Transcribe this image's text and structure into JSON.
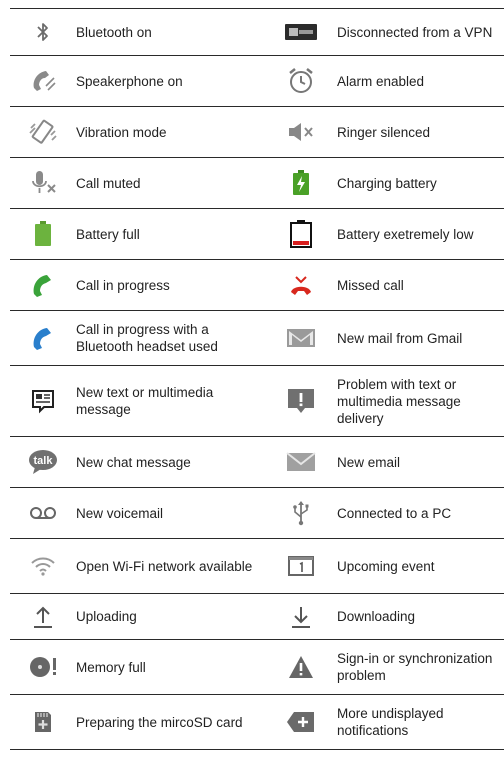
{
  "rows": [
    {
      "left": {
        "icon": "bluetooth-icon",
        "label": "Bluetooth on"
      },
      "right": {
        "icon": "vpn-disconnected-icon",
        "label": "Disconnected from a VPN"
      }
    },
    {
      "left": {
        "icon": "speakerphone-icon",
        "label": "Speakerphone on"
      },
      "right": {
        "icon": "alarm-clock-icon",
        "label": "Alarm enabled"
      }
    },
    {
      "left": {
        "icon": "vibration-icon",
        "label": "Vibration mode"
      },
      "right": {
        "icon": "ringer-silenced-icon",
        "label": "Ringer silenced"
      }
    },
    {
      "left": {
        "icon": "microphone-muted-icon",
        "label": "Call muted"
      },
      "right": {
        "icon": "charging-battery-icon",
        "label": "Charging battery"
      }
    },
    {
      "left": {
        "icon": "battery-full-icon",
        "label": "Battery full"
      },
      "right": {
        "icon": "battery-low-icon",
        "label": "Battery exetremely low"
      }
    },
    {
      "left": {
        "icon": "call-in-progress-icon",
        "label": "Call in progress"
      },
      "right": {
        "icon": "missed-call-icon",
        "label": "Missed call"
      }
    },
    {
      "left": {
        "icon": "bluetooth-call-icon",
        "label": "Call in progress with a Bluetooth headset used"
      },
      "right": {
        "icon": "gmail-icon",
        "label": "New mail from Gmail"
      }
    },
    {
      "left": {
        "icon": "text-message-icon",
        "label": "New text or multimedia message"
      },
      "right": {
        "icon": "message-problem-icon",
        "label": "Problem with text or multimedia message delivery"
      }
    },
    {
      "left": {
        "icon": "talk-chat-icon",
        "label": "New chat message"
      },
      "right": {
        "icon": "email-icon",
        "label": "New email"
      }
    },
    {
      "left": {
        "icon": "voicemail-icon",
        "label": "New voicemail"
      },
      "right": {
        "icon": "usb-icon",
        "label": "Connected to a PC"
      }
    },
    {
      "left": {
        "icon": "wifi-open-icon",
        "label": "Open Wi-Fi network available"
      },
      "right": {
        "icon": "calendar-event-icon",
        "label": "Upcoming event"
      }
    },
    {
      "left": {
        "icon": "upload-icon",
        "label": "Uploading"
      },
      "right": {
        "icon": "download-icon",
        "label": "Downloading"
      }
    },
    {
      "left": {
        "icon": "memory-full-icon",
        "label": "Memory full"
      },
      "right": {
        "icon": "warning-triangle-icon",
        "label": "Sign-in or synchronization problem"
      }
    },
    {
      "left": {
        "icon": "sd-card-icon",
        "label": "Preparing the mircoSD card"
      },
      "right": {
        "icon": "more-notifications-icon",
        "label": "More undisplayed notifications"
      }
    }
  ]
}
